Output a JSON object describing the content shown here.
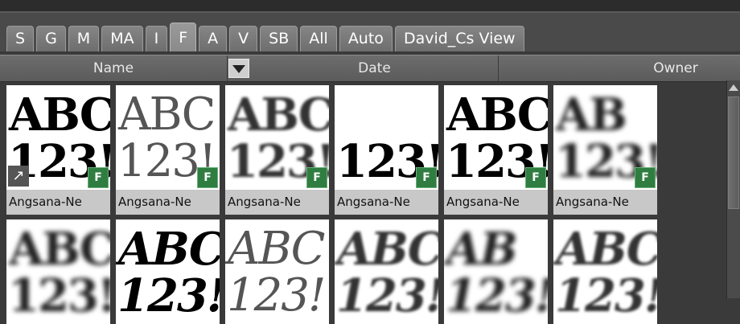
{
  "tabs": [
    {
      "label": "S",
      "active": false
    },
    {
      "label": "G",
      "active": false
    },
    {
      "label": "M",
      "active": false
    },
    {
      "label": "MA",
      "active": false
    },
    {
      "label": "I",
      "active": false
    },
    {
      "label": "F",
      "active": true
    },
    {
      "label": "A",
      "active": false
    },
    {
      "label": "V",
      "active": false
    },
    {
      "label": "SB",
      "active": false
    },
    {
      "label": "All",
      "active": false
    },
    {
      "label": "Auto",
      "active": false
    },
    {
      "label": "David_Cs View",
      "active": false
    }
  ],
  "columns": {
    "name": "Name",
    "date": "Date",
    "owner": "Owner"
  },
  "thumbnails": [
    {
      "top": "ABC",
      "bottom": "123!",
      "caption": "Angsana-Ne",
      "badge": "F",
      "style": "bold",
      "shortcut": true
    },
    {
      "top": "ABC",
      "bottom": "123!",
      "caption": "Angsana-Ne",
      "badge": "F",
      "style": "light",
      "shortcut": false
    },
    {
      "top": "ABC",
      "bottom": "123!",
      "caption": "Angsana-Ne",
      "badge": "F",
      "style": "blur1",
      "shortcut": false
    },
    {
      "top": "",
      "bottom": "123!",
      "caption": "Angsana-Ne",
      "badge": "F",
      "style": "bold",
      "shortcut": false
    },
    {
      "top": "ABC",
      "bottom": "123!",
      "caption": "Angsana-Ne",
      "badge": "F",
      "style": "bold",
      "shortcut": false
    },
    {
      "top": "AB",
      "bottom": "123!",
      "caption": "Angsana-Ne",
      "badge": "F",
      "style": "blur2",
      "shortcut": false
    },
    {
      "top": "ABC",
      "bottom": "123!",
      "caption": "",
      "badge": "",
      "style": "blur2",
      "shortcut": false
    },
    {
      "top": "ABC",
      "bottom": "123!",
      "caption": "",
      "badge": "",
      "style": "italic",
      "shortcut": false
    },
    {
      "top": "ABC",
      "bottom": "123!",
      "caption": "",
      "badge": "",
      "style": "italiclight",
      "shortcut": false
    },
    {
      "top": "ABC",
      "bottom": "123!",
      "caption": "",
      "badge": "",
      "style": "italicblur",
      "shortcut": false
    },
    {
      "top": "AB",
      "bottom": "123!",
      "caption": "",
      "badge": "",
      "style": "italicblur2",
      "shortcut": false
    },
    {
      "top": "ABC",
      "bottom": "123!",
      "caption": "",
      "badge": "",
      "style": "italicblur",
      "shortcut": false
    }
  ],
  "icons": {
    "sort": "chevron-down-icon",
    "shortcut": "shortcut-arrow-icon",
    "scroll_up": "arrow-up-icon"
  },
  "colors": {
    "badge": "#2f7d40",
    "caption_bg": "#c8c8c8",
    "panel_bg": "#3a3a3a"
  }
}
